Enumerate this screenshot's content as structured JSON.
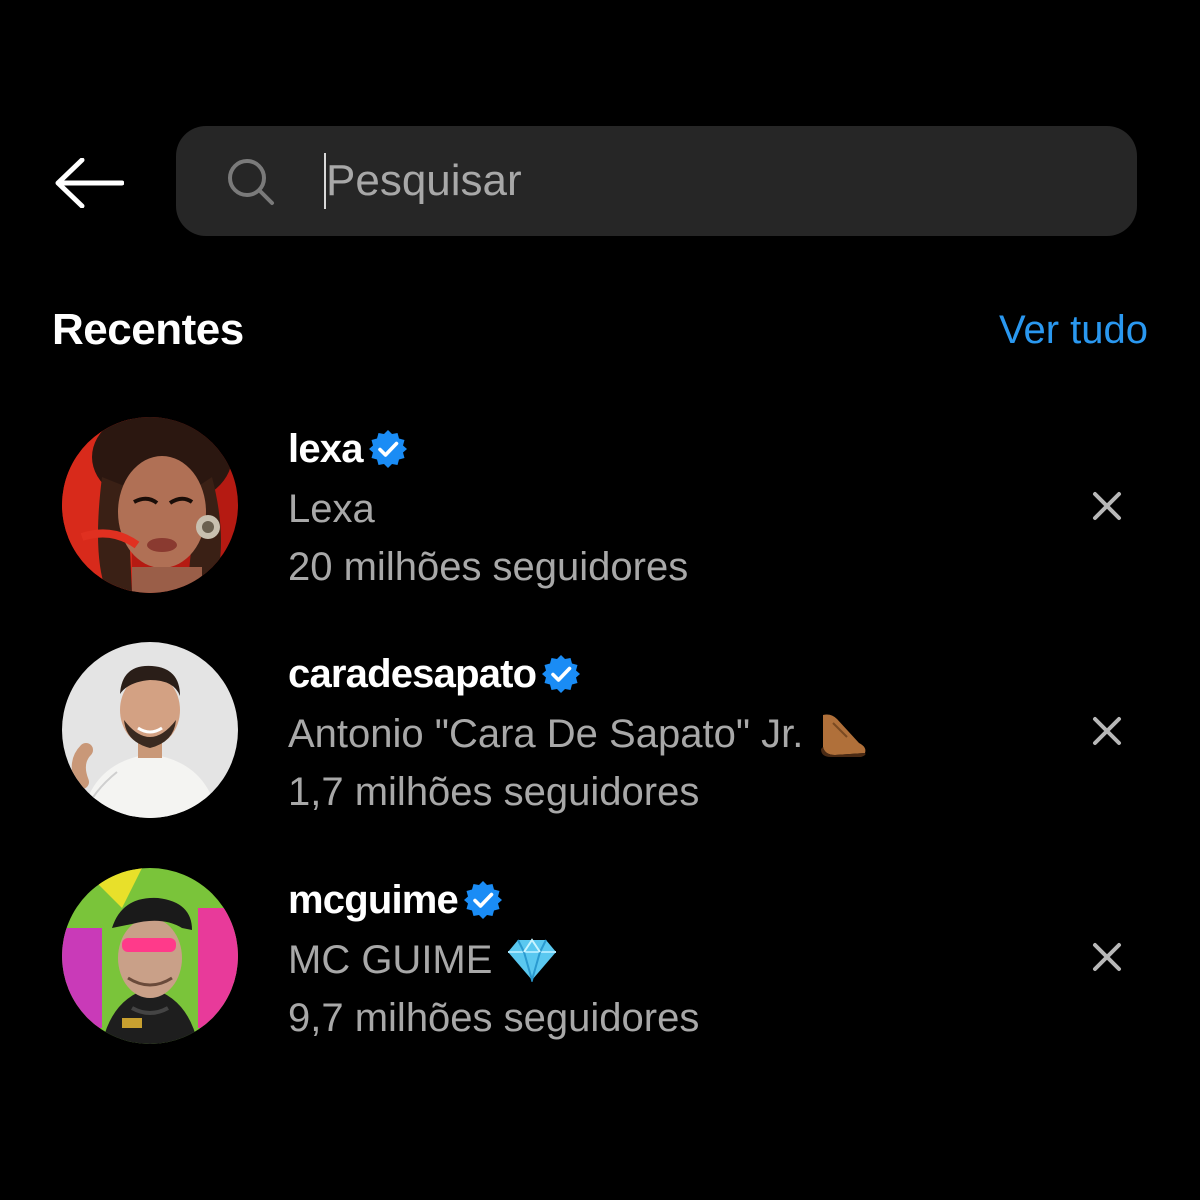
{
  "header": {
    "back_icon": "arrow-left-icon",
    "search": {
      "icon": "search-icon",
      "placeholder": "Pesquisar",
      "value": ""
    }
  },
  "recent": {
    "title": "Recentes",
    "see_all": "Ver tudo",
    "items": [
      {
        "username": "lexa",
        "verified": true,
        "full_name": "Lexa",
        "emoji": "",
        "followers": "20 milhões seguidores",
        "remove_icon": "close-icon"
      },
      {
        "username": "caradesapato",
        "verified": true,
        "full_name": "Antonio \"Cara De Sapato\" Jr.",
        "emoji": "shoe-emoji",
        "followers": "1,7 milhões seguidores",
        "remove_icon": "close-icon"
      },
      {
        "username": "mcguime",
        "verified": true,
        "full_name": "MC GUIME",
        "emoji": "gem-emoji",
        "followers": "9,7 milhões seguidores",
        "remove_icon": "close-icon"
      }
    ]
  },
  "colors": {
    "background": "#000000",
    "search_bg": "#262626",
    "secondary_text": "#a8a8a8",
    "link": "#2a98f0",
    "verified_badge": "#1a8cf5"
  }
}
